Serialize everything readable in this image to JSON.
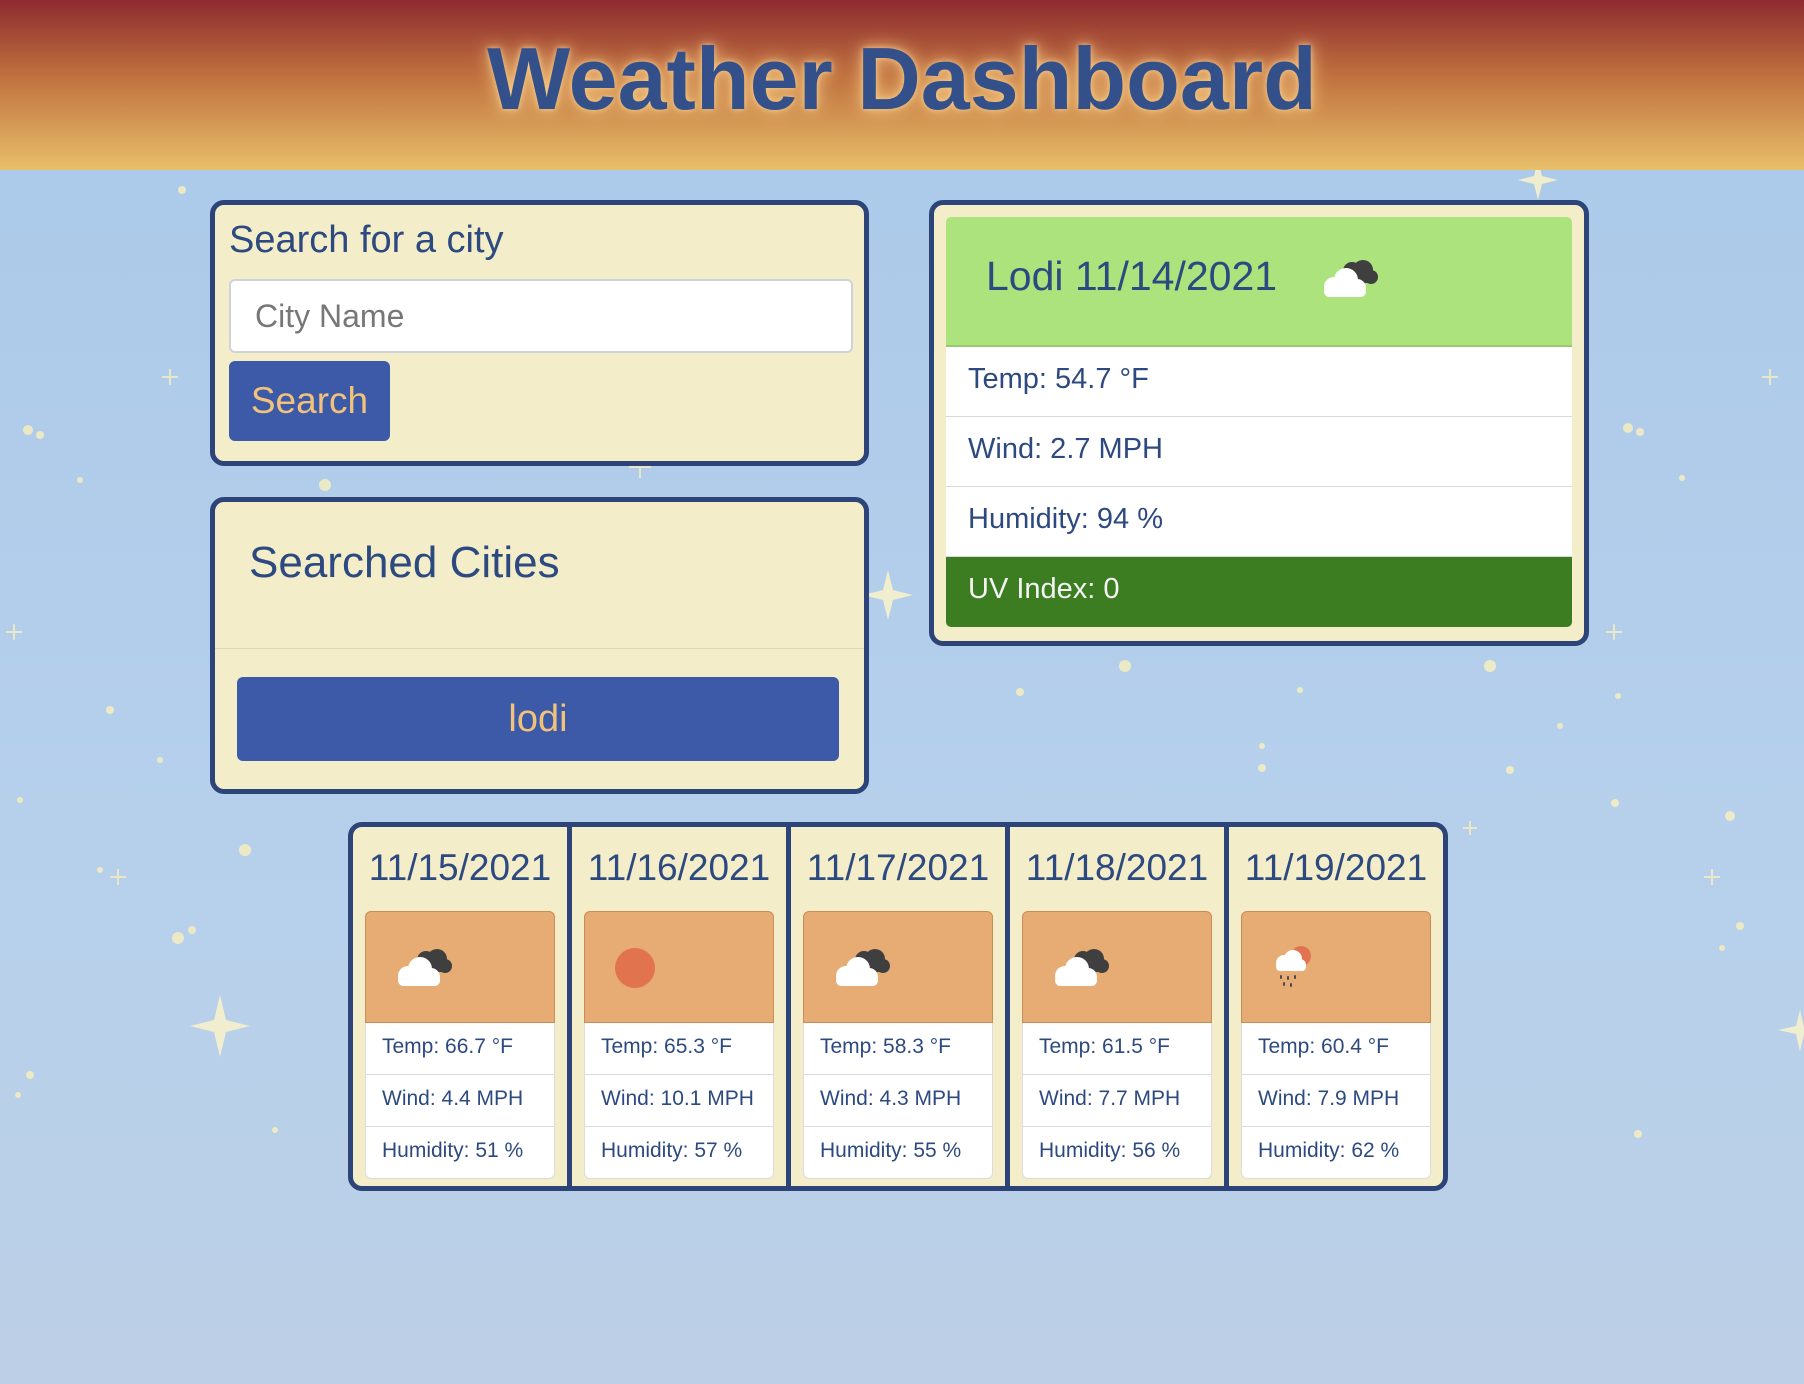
{
  "header": {
    "title": "Weather Dashboard"
  },
  "search": {
    "heading": "Search for a city",
    "placeholder": "City Name",
    "button_label": "Search"
  },
  "history": {
    "heading": "Searched Cities",
    "items": [
      "lodi"
    ]
  },
  "current": {
    "title": "Lodi 11/14/2021",
    "icon": "partly-cloudy-icon",
    "temp": "Temp: 54.7 °F",
    "wind": "Wind: 2.7 MPH",
    "humidity": "Humidity: 94 %",
    "uv": "UV Index: 0",
    "uv_color": "#3b7d20",
    "header_color": "#ade37c"
  },
  "forecast": [
    {
      "date": "11/15/2021",
      "icon": "cloudy-icon",
      "temp": "Temp: 66.7 °F",
      "wind": "Wind: 4.4 MPH",
      "humidity": "Humidity: 51 %"
    },
    {
      "date": "11/16/2021",
      "icon": "sun-icon",
      "temp": "Temp: 65.3 °F",
      "wind": "Wind: 10.1 MPH",
      "humidity": "Humidity: 57 %"
    },
    {
      "date": "11/17/2021",
      "icon": "cloudy-icon",
      "temp": "Temp: 58.3 °F",
      "wind": "Wind: 4.3 MPH",
      "humidity": "Humidity: 55 %"
    },
    {
      "date": "11/18/2021",
      "icon": "cloudy-icon",
      "temp": "Temp: 61.5 °F",
      "wind": "Wind: 7.7 MPH",
      "humidity": "Humidity: 56 %"
    },
    {
      "date": "11/19/2021",
      "icon": "rain-sun-icon",
      "temp": "Temp: 60.4 °F",
      "wind": "Wind: 7.9 MPH",
      "humidity": "Humidity: 62 %"
    }
  ],
  "colors": {
    "panel_bg": "#f3edc9",
    "panel_border": "#2c4478",
    "button_bg": "#3d5aa8",
    "button_text": "#f1c27a",
    "forecast_image_bg": "#e6ac74"
  }
}
